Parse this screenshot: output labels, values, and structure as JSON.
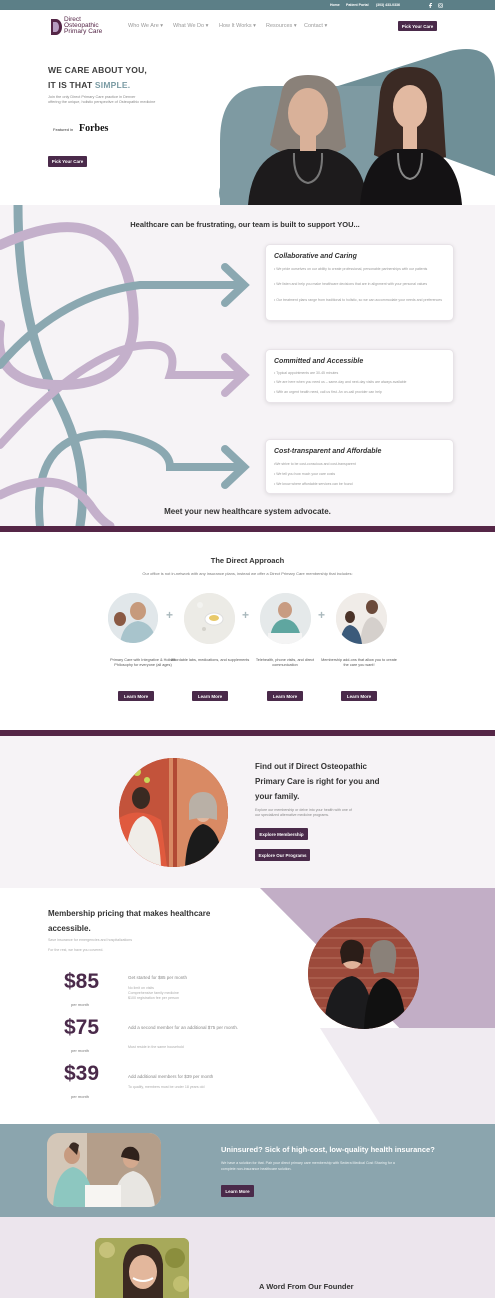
{
  "topbar": {
    "home": "Home",
    "portal": "Patient Portal",
    "phone": "(303) 433-0336"
  },
  "logo": {
    "line1": "Direct",
    "line2": "Osteopathic",
    "line3": "Primary Care"
  },
  "nav": {
    "items": [
      "Who We Are",
      "What We Do",
      "How It Works",
      "Resources",
      "Contact"
    ],
    "cta": "Pick Your Care"
  },
  "hero": {
    "line1": "WE CARE ABOUT YOU,",
    "line2a": "IT IS THAT ",
    "line2b": "SIMPLE.",
    "desc1": "Join the only Direct Primary Care practice in Denver",
    "desc2": "offering the unique, holistic perspective of Osteopathic medicine",
    "featured": "Featured in",
    "forbes": "Forbes",
    "cta": "Pick Your Care"
  },
  "support": {
    "title": "Healthcare can be frustrating, our team is built to support YOU...",
    "cards": [
      {
        "title": "Collaborative and Caring",
        "bullets": [
          "• We pride ourselves on our ability to create professional, personable partnerships with our patients",
          "• We listen and help you make healthcare decisions that are in alignment with your personal values",
          "• Our treatment plans range from traditional to holistic, so we can accommodate your needs and preferences"
        ]
      },
      {
        "title": "Committed and Accessible",
        "bullets": [
          "• Typical appointments are 30-45 minutes",
          "• We are here when you need us – same-day and next-day visits are always available",
          "• With an urgent health need, call us first. An on-call provider can help"
        ]
      },
      {
        "title": "Cost-transparent and Affordable",
        "bullets": [
          "•We strive to be cost-conscious and cost-transparent",
          "• We tell you how much your care costs",
          "• We know where affordable services can be found"
        ]
      }
    ],
    "footer": "Meet your new healthcare system advocate."
  },
  "approach": {
    "title": "The Direct Approach",
    "subtitle": "Our office is not in-network with any insurance plans, instead we offer a Direct Primary Care membership that includes:",
    "items": [
      {
        "text": "Primary Care with Integrative & Holistic Philosophy for everyone (all ages)",
        "btn": "Learn More"
      },
      {
        "text": "Affordable labs, medications, and supplements",
        "btn": "Learn More"
      },
      {
        "text": "Telehealth, phone visits, and direct communication",
        "btn": "Learn More"
      },
      {
        "text": "Membership add-ons that allow you to create the care you want!",
        "btn": "Learn More"
      }
    ]
  },
  "findout": {
    "line1": "Find out if Direct Osteopathic",
    "line2": "Primary Care is right for you and",
    "line3": "your family.",
    "desc1": "Explore our membership or delve into your health with one of",
    "desc2": "our specialized alternative medicine programs.",
    "btn1": "Explore Membership",
    "btn2": "Explore Our Programs"
  },
  "pricing": {
    "title1": "Membership pricing that makes healthcare",
    "title2": "accessible.",
    "sub1": "Save insurance for emergencies and hospitalizations",
    "sub2": "For the rest, we have you covered.",
    "tiers": [
      {
        "price": "$85",
        "per": "per month",
        "desc": "Get started for $85 per month",
        "details": [
          "No limit on visits",
          "Comprehensive family medicine",
          "$100 registration fee per person"
        ]
      },
      {
        "price": "$75",
        "per": "per month",
        "desc": "Add a second member for an additional $75 per month.",
        "details": [
          "Must reside in the same household"
        ]
      },
      {
        "price": "$39",
        "per": "per month",
        "desc": "Add additional members for $39 per month",
        "details": [
          "To qualify, members must be under 18 years old"
        ]
      }
    ]
  },
  "insurance": {
    "title": "Uninsured? Sick of high-cost, low-quality health insurance?",
    "desc1": "We have a solution for that. Pair your direct primary care membership with Sedera Medical Cost Sharing for a",
    "desc2": "complete non-insurance healthcare solution.",
    "btn": "Learn More"
  },
  "founder": {
    "title": "A Word From Our Founder"
  },
  "colors": {
    "accent": "#4a2a4a",
    "teal": "#8ba8b1",
    "lilac": "#c4b0cb",
    "plum": "#552647"
  }
}
